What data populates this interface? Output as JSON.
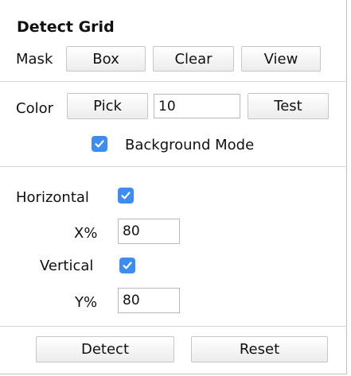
{
  "panel": {
    "title": "Detect Grid"
  },
  "mask": {
    "label": "Mask",
    "box_label": "Box",
    "clear_label": "Clear",
    "view_label": "View"
  },
  "color": {
    "label": "Color",
    "pick_label": "Pick",
    "tolerance_value": "10",
    "test_label": "Test"
  },
  "background_mode": {
    "label": "Background Mode",
    "checked": true
  },
  "horizontal": {
    "label": "Horizontal",
    "checked": true,
    "x_label": "X%",
    "x_value": "80"
  },
  "vertical": {
    "label": "Vertical",
    "checked": true,
    "y_label": "Y%",
    "y_value": "80"
  },
  "actions": {
    "detect_label": "Detect",
    "reset_label": "Reset"
  },
  "colors": {
    "checkbox_accent": "#3d8cf2",
    "separator": "#d4d4d4"
  },
  "icons": {
    "checkbox": "checkmark-icon"
  }
}
